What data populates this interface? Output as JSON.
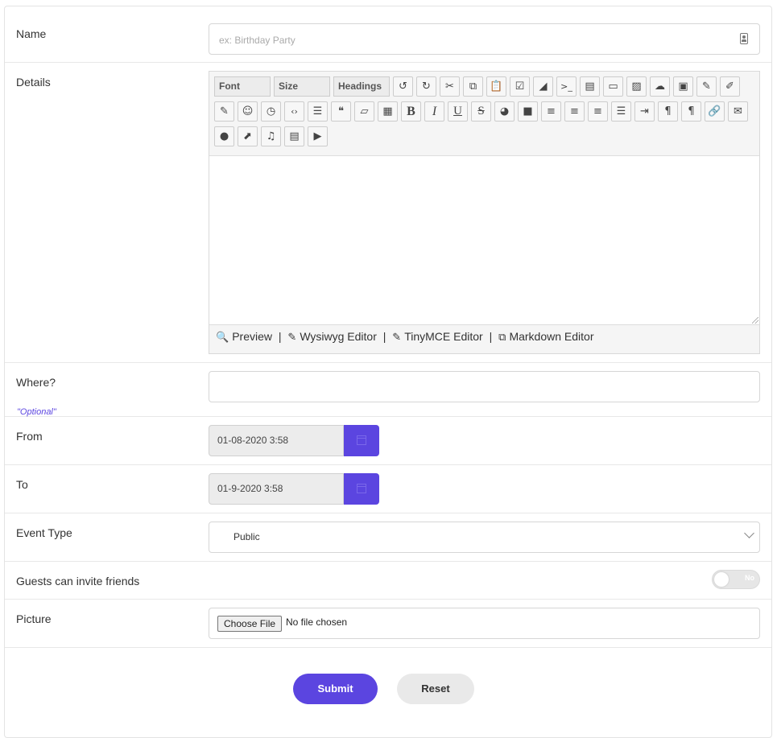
{
  "form": {
    "name": {
      "label": "Name",
      "placeholder": "ex: Birthday Party",
      "icon": "contact-card-icon"
    },
    "details": {
      "label": "Details",
      "toolbar": {
        "selects": [
          "Font",
          "Size",
          "Headings"
        ],
        "row1_icons": [
          "undo-icon",
          "redo-icon",
          "cut-icon",
          "copy-icon",
          "paste-icon",
          "checkbox-icon",
          "eraser-icon",
          "terminal-icon",
          "file-icon",
          "rectangle-icon",
          "image-icon",
          "cloud-upload-icon",
          "archive-icon",
          "pen-icon",
          "edit-icon"
        ],
        "row2_icons": [
          "edit-square-icon",
          "smiley-icon",
          "history-icon",
          "code-icon",
          "list-icon",
          "quote-icon",
          "folder-open-icon",
          "qr-code-icon",
          "bold-icon",
          "italic-icon",
          "underline-icon",
          "strikethrough-icon",
          "palette-icon",
          "square-fill-icon",
          "align-right-icon",
          "align-center-icon",
          "align-left-icon",
          "justify-icon",
          "indent-icon",
          "rtl-paragraph-icon",
          "ltr-paragraph-icon",
          "link-icon",
          "envelope-icon"
        ],
        "row3_icons": [
          "speech-bubble-icon",
          "external-link-icon",
          "music-icon",
          "clapperboard-icon",
          "video-play-icon"
        ]
      },
      "footer": {
        "preview": "Preview",
        "wysiwyg": "Wysiwyg Editor",
        "tinymce": "TinyMCE Editor",
        "markdown": "Markdown Editor",
        "separator": "|"
      }
    },
    "where": {
      "label": "Where?",
      "hint": "\"Optional\""
    },
    "from": {
      "label": "From",
      "value": "01-08-2020 3:58"
    },
    "to": {
      "label": "To",
      "value": "01-9-2020 3:58"
    },
    "event_type": {
      "label": "Event Type",
      "value": "Public"
    },
    "guests": {
      "label": "Guests can invite friends",
      "toggle_text": "No",
      "enabled": false
    },
    "picture": {
      "label": "Picture",
      "button": "Choose File",
      "status": "No file chosen"
    },
    "actions": {
      "submit": "Submit",
      "reset": "Reset"
    }
  },
  "colors": {
    "accent": "#5b45e0"
  }
}
